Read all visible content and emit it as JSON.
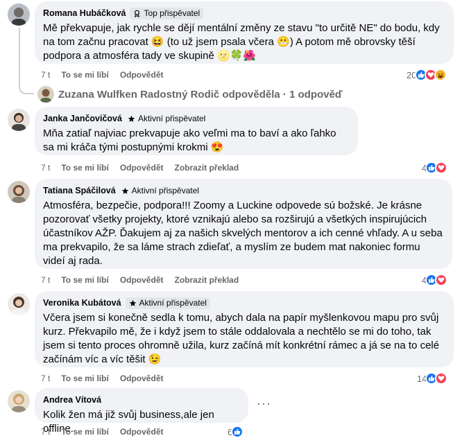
{
  "comments": [
    {
      "author": "Romana Hubáčková",
      "badge": "Top přispěvatel",
      "text": "Mě překvapuje, jak rychle se dějí mentální změny ze stavu \"to určitě NE\" do bodu, kdy na tom začnu pracovat 😆 (to už jsem psala včera 😬) A potom mě obrovsky těší podpora a atmosféra tady ve skupině 🌝🍀🌺",
      "time": "7 t",
      "like": "To se mi líbí",
      "reply": "Odpovědět",
      "reaction_count": "20",
      "reactions": [
        "like",
        "love",
        "haha"
      ]
    },
    {
      "author": "Janka Jančovičová",
      "badge": "Aktivní přispěvatel",
      "text": "Mňa zatiaľ najviac prekvapuje ako veľmi ma to baví a ako ľahko sa mi kráča tými postupnými krokmi 😍",
      "time": "7 t",
      "like": "To se mi líbí",
      "reply": "Odpovědět",
      "translate": "Zobrazit překlad",
      "reaction_count": "4",
      "reactions": [
        "like",
        "love"
      ]
    },
    {
      "author": "Tatiana Spáčilová",
      "badge": "Aktivní přispěvatel",
      "text": "Atmosféra, bezpečie, podpora!!! Zoomy a Luckine odpovede sú božské. Je krásne pozorovať všetky projekty, ktoré vznikajú alebo sa rozširujú a všetkých inspirujúcich účastníkov AŽP. Ďakujem aj za našich skvelých mentorov a ich cenné vhľady. A u seba ma prekvapilo, že sa láme strach zdieľať, a myslím ze budem mat nakoniec formu videí aj rada.",
      "time": "7 t",
      "like": "To se mi líbí",
      "reply": "Odpovědět",
      "translate": "Zobrazit překlad",
      "reaction_count": "4",
      "reactions": [
        "like",
        "love"
      ]
    },
    {
      "author": "Veronika Kubátová",
      "badge": "Aktivní přispěvatel",
      "text": "Včera jsem si konečně sedla k tomu, abych dala na papír myšlenkovou mapu pro svůj kurz. Překvapilo mě, že i když jsem to stále oddalovala a nechtělo se mi do toho, tak jsem si tento proces ohromně užila, kurz začíná mít konkrétní rámec a já se na to celé začínám víc a víc těšit 😉",
      "time": "7 t",
      "like": "To se mi líbí",
      "reply": "Odpovědět",
      "reaction_count": "14",
      "reactions": [
        "like",
        "love"
      ]
    },
    {
      "author": "Andrea Vítová",
      "text": "Kolik žen má již svůj business,ale jen offline.",
      "time": "7 t",
      "like": "To se mi líbí",
      "reply": "Odpovědět",
      "reaction_count": "6",
      "reactions": [
        "like"
      ],
      "more": "···"
    }
  ],
  "reply_summary": "Zuzana Wulfken Radostný Rodič odpověděla · 1 odpověď",
  "colors": {
    "like": "#1877f2",
    "love": "#f33e58",
    "haha": "#f7b125",
    "bubble": "#f0f2f5",
    "meta": "#65676b"
  }
}
